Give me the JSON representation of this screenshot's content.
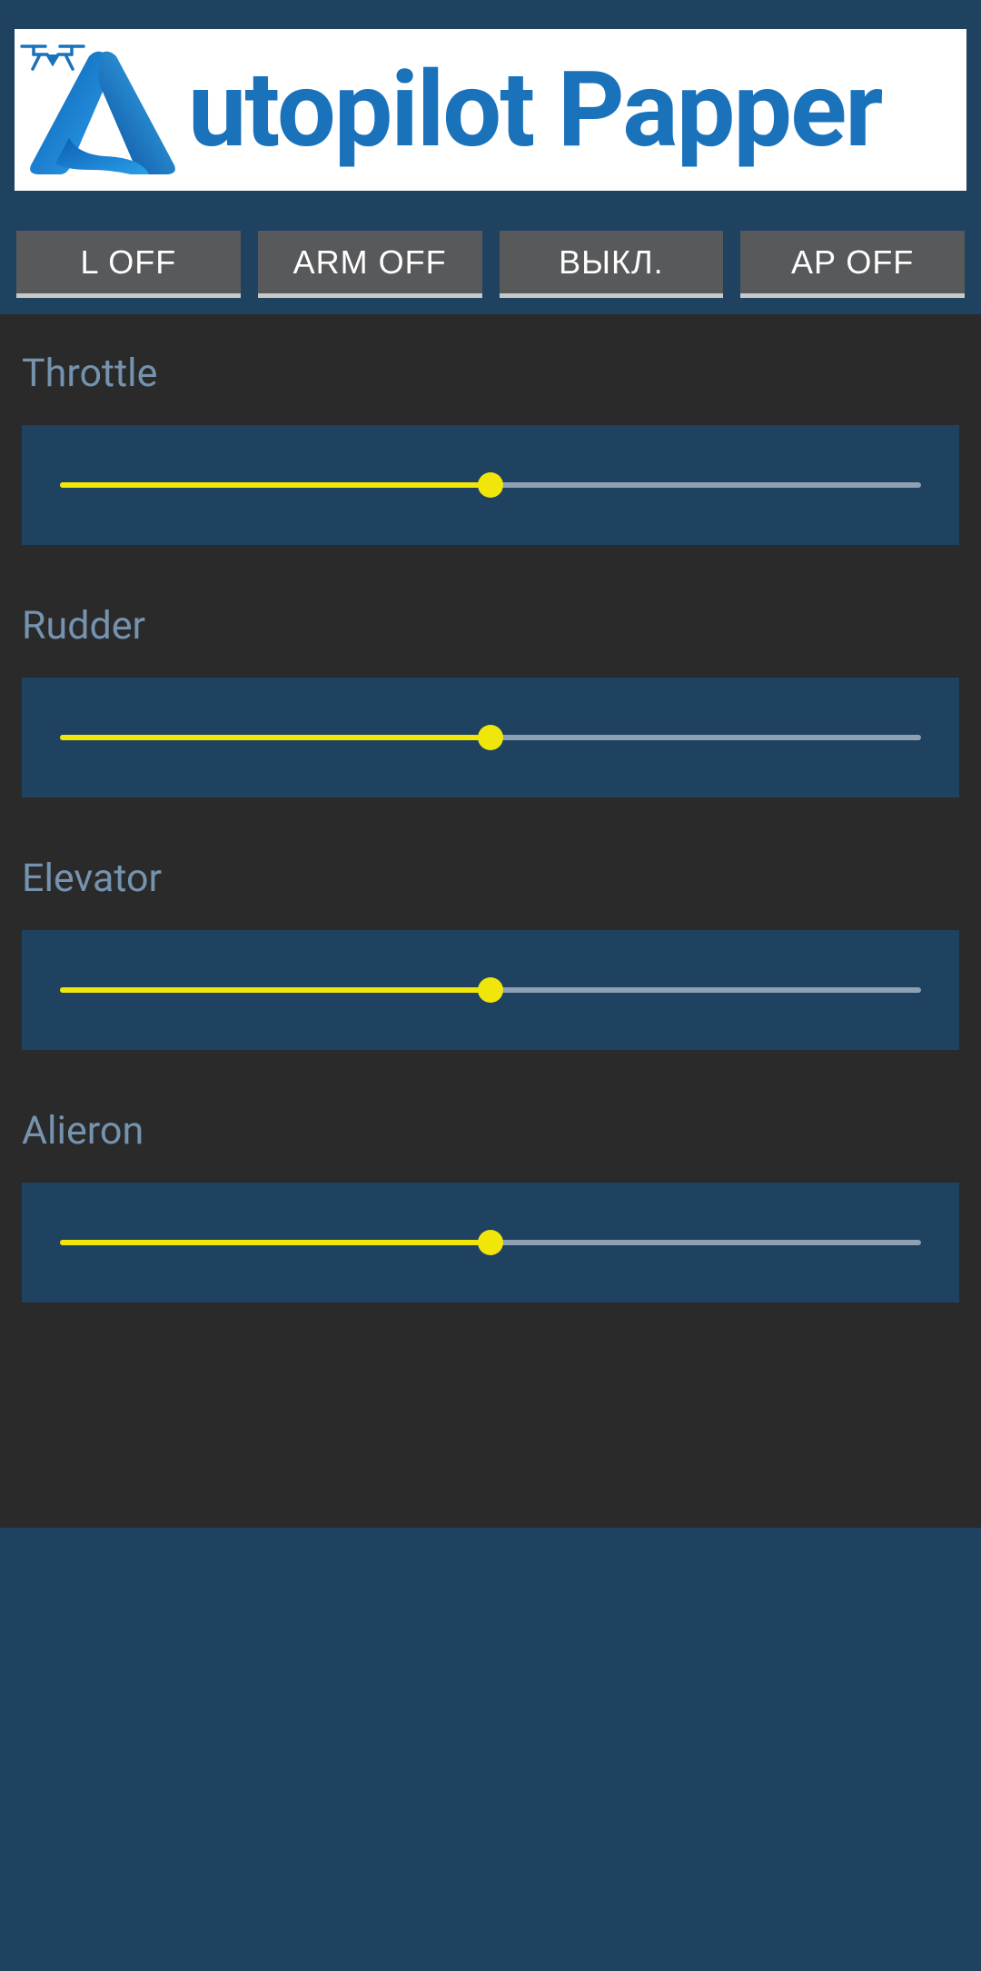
{
  "header": {
    "brand_text": "utopilot Papper"
  },
  "buttons": {
    "l": "L OFF",
    "arm": "ARM OFF",
    "vykl": "ВЫКЛ.",
    "ap": "AP OFF"
  },
  "controls": {
    "throttle": {
      "label": "Throttle",
      "value": 50
    },
    "rudder": {
      "label": "Rudder",
      "value": 50
    },
    "elevator": {
      "label": "Elevator",
      "value": 50
    },
    "alieron": {
      "label": "Alieron",
      "value": 50
    }
  },
  "colors": {
    "bg": "#1f4261",
    "panel": "#2a2a2a",
    "button": "#58595b",
    "label": "#7593ae",
    "slider_fill": "#f1e60a",
    "slider_track": "#8ea0b3",
    "brand": "#1a72bb"
  }
}
